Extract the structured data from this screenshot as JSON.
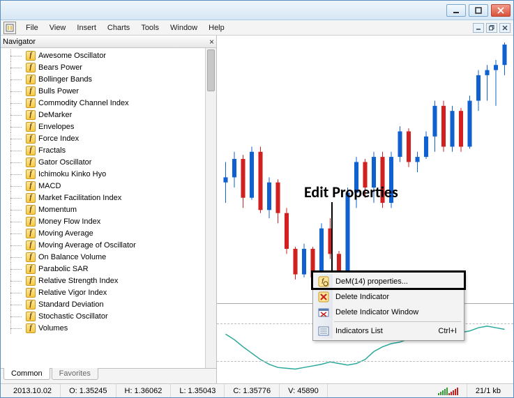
{
  "menubar": [
    "File",
    "View",
    "Insert",
    "Charts",
    "Tools",
    "Window",
    "Help"
  ],
  "navigator": {
    "title": "Navigator",
    "items": [
      "Awesome Oscillator",
      "Bears Power",
      "Bollinger Bands",
      "Bulls Power",
      "Commodity Channel Index",
      "DeMarker",
      "Envelopes",
      "Force Index",
      "Fractals",
      "Gator Oscillator",
      "Ichimoku Kinko Hyo",
      "MACD",
      "Market Facilitation Index",
      "Momentum",
      "Money Flow Index",
      "Moving Average",
      "Moving Average of Oscillator",
      "On Balance Volume",
      "Parabolic SAR",
      "Relative Strength Index",
      "Relative Vigor Index",
      "Standard Deviation",
      "Stochastic Oscillator",
      "Volumes"
    ],
    "tabs": {
      "common": "Common",
      "favorites": "Favorites"
    }
  },
  "annotation": "Edit Properties",
  "context_menu": {
    "properties": "DeM(14) properties...",
    "delete_indicator": "Delete Indicator",
    "delete_window": "Delete Indicator Window",
    "indicators_list": "Indicators List",
    "indicators_shortcut": "Ctrl+I"
  },
  "statusbar": {
    "date": "2013.10.02",
    "o": "O: 1.35245",
    "h": "H: 1.36062",
    "l": "L: 1.35043",
    "c": "C: 1.35776",
    "v": "V: 45890",
    "kb": "21/1 kb"
  },
  "chart_data": {
    "type": "candlestick",
    "note": "Values approximated from pixel positions; no axis labels present.",
    "series": [
      {
        "o": 1.3525,
        "h": 1.3545,
        "l": 1.3505,
        "c": 1.353,
        "dir": "up"
      },
      {
        "o": 1.353,
        "h": 1.3555,
        "l": 1.352,
        "c": 1.3548,
        "dir": "up"
      },
      {
        "o": 1.3548,
        "h": 1.3552,
        "l": 1.35,
        "c": 1.351,
        "dir": "down"
      },
      {
        "o": 1.351,
        "h": 1.356,
        "l": 1.3508,
        "c": 1.3555,
        "dir": "up"
      },
      {
        "o": 1.3555,
        "h": 1.356,
        "l": 1.3495,
        "c": 1.3498,
        "dir": "down"
      },
      {
        "o": 1.3498,
        "h": 1.353,
        "l": 1.349,
        "c": 1.3525,
        "dir": "up"
      },
      {
        "o": 1.3525,
        "h": 1.3528,
        "l": 1.3485,
        "c": 1.3495,
        "dir": "down"
      },
      {
        "o": 1.3495,
        "h": 1.35,
        "l": 1.3455,
        "c": 1.346,
        "dir": "down"
      },
      {
        "o": 1.346,
        "h": 1.3462,
        "l": 1.343,
        "c": 1.3435,
        "dir": "down"
      },
      {
        "o": 1.3435,
        "h": 1.3465,
        "l": 1.3432,
        "c": 1.346,
        "dir": "up"
      },
      {
        "o": 1.346,
        "h": 1.3462,
        "l": 1.343,
        "c": 1.3432,
        "dir": "down"
      },
      {
        "o": 1.3432,
        "h": 1.3485,
        "l": 1.343,
        "c": 1.348,
        "dir": "up"
      },
      {
        "o": 1.348,
        "h": 1.349,
        "l": 1.345,
        "c": 1.3455,
        "dir": "down"
      },
      {
        "o": 1.3455,
        "h": 1.3458,
        "l": 1.341,
        "c": 1.3415,
        "dir": "down"
      },
      {
        "o": 1.3415,
        "h": 1.352,
        "l": 1.341,
        "c": 1.3515,
        "dir": "up"
      },
      {
        "o": 1.3515,
        "h": 1.355,
        "l": 1.35,
        "c": 1.3545,
        "dir": "up"
      },
      {
        "o": 1.3545,
        "h": 1.3548,
        "l": 1.351,
        "c": 1.352,
        "dir": "down"
      },
      {
        "o": 1.352,
        "h": 1.3555,
        "l": 1.3505,
        "c": 1.355,
        "dir": "up"
      },
      {
        "o": 1.355,
        "h": 1.3555,
        "l": 1.35,
        "c": 1.3505,
        "dir": "down"
      },
      {
        "o": 1.3505,
        "h": 1.3555,
        "l": 1.35,
        "c": 1.355,
        "dir": "up"
      },
      {
        "o": 1.355,
        "h": 1.358,
        "l": 1.3545,
        "c": 1.3575,
        "dir": "up"
      },
      {
        "o": 1.3575,
        "h": 1.3578,
        "l": 1.354,
        "c": 1.3545,
        "dir": "down"
      },
      {
        "o": 1.3545,
        "h": 1.3555,
        "l": 1.3535,
        "c": 1.355,
        "dir": "up"
      },
      {
        "o": 1.355,
        "h": 1.3575,
        "l": 1.3548,
        "c": 1.357,
        "dir": "up"
      },
      {
        "o": 1.357,
        "h": 1.3605,
        "l": 1.3555,
        "c": 1.36,
        "dir": "up"
      },
      {
        "o": 1.36,
        "h": 1.3605,
        "l": 1.3555,
        "c": 1.356,
        "dir": "down"
      },
      {
        "o": 1.356,
        "h": 1.36,
        "l": 1.3555,
        "c": 1.3595,
        "dir": "up"
      },
      {
        "o": 1.3595,
        "h": 1.3598,
        "l": 1.3555,
        "c": 1.356,
        "dir": "down"
      },
      {
        "o": 1.356,
        "h": 1.361,
        "l": 1.3558,
        "c": 1.3605,
        "dir": "up"
      },
      {
        "o": 1.3605,
        "h": 1.3635,
        "l": 1.3595,
        "c": 1.363,
        "dir": "up"
      },
      {
        "o": 1.363,
        "h": 1.364,
        "l": 1.3605,
        "c": 1.3635,
        "dir": "up"
      },
      {
        "o": 1.3635,
        "h": 1.3645,
        "l": 1.36,
        "c": 1.364,
        "dir": "up"
      },
      {
        "o": 1.364,
        "h": 1.3662,
        "l": 1.363,
        "c": 1.366,
        "dir": "up"
      }
    ],
    "indicator": {
      "name": "DeM(14)",
      "ylim": [
        0,
        1
      ],
      "ref_lines": [
        0.3,
        0.7
      ],
      "values": [
        0.62,
        0.55,
        0.46,
        0.38,
        0.3,
        0.24,
        0.2,
        0.19,
        0.18,
        0.2,
        0.22,
        0.24,
        0.27,
        0.25,
        0.23,
        0.25,
        0.3,
        0.4,
        0.46,
        0.5,
        0.52,
        0.56,
        0.62,
        0.7,
        0.73,
        0.67,
        0.65,
        0.64,
        0.66,
        0.7,
        0.72,
        0.7,
        0.68
      ]
    }
  }
}
